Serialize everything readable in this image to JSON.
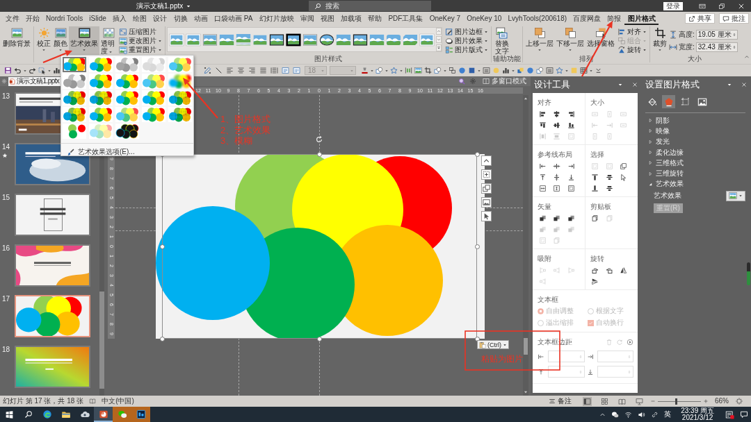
{
  "window": {
    "title": "演示文稿1.pptx",
    "search_placeholder": "搜索",
    "sign_in": "登录"
  },
  "tabs": [
    {
      "label": "文件",
      "selected": false
    },
    {
      "label": "开始",
      "selected": false
    },
    {
      "label": "Nordri Tools",
      "selected": false
    },
    {
      "label": "iSlide",
      "selected": false
    },
    {
      "label": "插入",
      "selected": false
    },
    {
      "label": "绘图",
      "selected": false
    },
    {
      "label": "设计",
      "selected": false
    },
    {
      "label": "切换",
      "selected": false
    },
    {
      "label": "动画",
      "selected": false
    },
    {
      "label": "口袋动画 PA",
      "selected": false
    },
    {
      "label": "幻灯片放映",
      "selected": false
    },
    {
      "label": "审阅",
      "selected": false
    },
    {
      "label": "视图",
      "selected": false
    },
    {
      "label": "加载项",
      "selected": false
    },
    {
      "label": "帮助",
      "selected": false
    },
    {
      "label": "PDF工具集",
      "selected": false
    },
    {
      "label": "OneKey 7",
      "selected": false
    },
    {
      "label": "OneKey 10",
      "selected": false
    },
    {
      "label": "LvyhTools(200618)",
      "selected": false
    },
    {
      "label": "百度网盘",
      "selected": false
    },
    {
      "label": "简报",
      "selected": false
    },
    {
      "label": "图片格式",
      "selected": true
    }
  ],
  "header_buttons": [
    {
      "kind": "share",
      "label": "共享"
    },
    {
      "kind": "comments",
      "label": "批注"
    }
  ],
  "ribbon": {
    "remove_background": "删除背景",
    "adjust": [
      {
        "kind": "correction",
        "label": "校正",
        "pressed": false
      },
      {
        "kind": "color",
        "label": "颜色",
        "pressed": false
      },
      {
        "kind": "artistic",
        "label": "艺术效果",
        "pressed": true
      },
      {
        "kind": "transparency",
        "label": "透明度",
        "pressed": false
      }
    ],
    "image_actions": [
      {
        "kind": "compress",
        "label": "压缩图片",
        "menu": false
      },
      {
        "kind": "change",
        "label": "更改图片",
        "menu": true
      },
      {
        "kind": "reset",
        "label": "重置图片",
        "menu": true
      }
    ],
    "styles": {
      "label": "图片样式",
      "items": [
        {
          "kind": "white-frame",
          "selected": false
        },
        {
          "kind": "white-frame",
          "selected": false
        },
        {
          "kind": "thin-frame",
          "selected": false
        },
        {
          "kind": "plain",
          "selected": false
        },
        {
          "kind": "reflection",
          "selected": false
        },
        {
          "kind": "soft-edge",
          "selected": false
        },
        {
          "kind": "black-frame",
          "selected": false
        },
        {
          "kind": "thick-black-frame",
          "selected": false
        },
        {
          "kind": "thin-frame",
          "selected": false
        },
        {
          "kind": "oval",
          "selected": false
        },
        {
          "kind": "plain",
          "selected": false
        },
        {
          "kind": "black-frame",
          "selected": false
        },
        {
          "kind": "plain",
          "selected": false
        },
        {
          "kind": "rounded",
          "selected": false
        },
        {
          "kind": "cut-corner",
          "selected": false
        },
        {
          "kind": "white-frame",
          "selected": false
        }
      ]
    },
    "picture_options": [
      {
        "kind": "border",
        "label": "图片边框"
      },
      {
        "kind": "effects",
        "label": "图片效果"
      },
      {
        "kind": "layout",
        "label": "图片版式"
      }
    ],
    "accessibility": {
      "button": "替换文字",
      "label": "辅助功能"
    },
    "arrange": {
      "label": "排列",
      "buttons": [
        {
          "kind": "forward",
          "label": "上移一层",
          "menu": true
        },
        {
          "kind": "backward",
          "label": "下移一层",
          "menu": true
        },
        {
          "kind": "pane",
          "label": "选择窗格",
          "menu": false
        }
      ],
      "options": [
        {
          "kind": "align",
          "label": "对齐",
          "disabled": false
        },
        {
          "kind": "group",
          "label": "组合",
          "disabled": true
        },
        {
          "kind": "rotate",
          "label": "旋转",
          "disabled": false
        }
      ]
    },
    "size": {
      "label": "大小",
      "crop": "裁剪",
      "height_label": "高度:",
      "height": "19.05 厘米",
      "width_label": "宽度:",
      "width": "32.43 厘米"
    }
  },
  "quick_access": {
    "font_size": {
      "value": "18",
      "disabled": true
    }
  },
  "art_effects_menu": {
    "items": [
      {
        "kind": "normal",
        "selected": true
      },
      {
        "kind": "normal",
        "selected": false
      },
      {
        "kind": "grayscale",
        "selected": false
      },
      {
        "kind": "sketch",
        "selected": false
      },
      {
        "kind": "soft",
        "selected": false
      },
      {
        "kind": "grayscale",
        "selected": false
      },
      {
        "kind": "normal",
        "selected": false
      },
      {
        "kind": "normal",
        "selected": false
      },
      {
        "kind": "soft",
        "selected": false
      },
      {
        "kind": "blur",
        "selected": false
      },
      {
        "kind": "textured",
        "selected": false
      },
      {
        "kind": "textured",
        "selected": false
      },
      {
        "kind": "normal",
        "selected": false
      },
      {
        "kind": "normal",
        "selected": false
      },
      {
        "kind": "textured",
        "selected": false
      },
      {
        "kind": "textured",
        "selected": false
      },
      {
        "kind": "normal",
        "selected": false
      },
      {
        "kind": "soft",
        "selected": false
      },
      {
        "kind": "normal",
        "selected": false
      },
      {
        "kind": "textured",
        "selected": false
      },
      {
        "kind": "muted",
        "selected": false
      },
      {
        "kind": "pastel",
        "selected": false
      },
      {
        "kind": "dark",
        "selected": false
      }
    ],
    "options_item": "艺术效果选项(E)..."
  },
  "document_tab": {
    "title": "演示文稿1.pptx"
  },
  "multi_window": "多窗口模式",
  "slides": [
    {
      "number": "13",
      "kind": "city-photo",
      "selected": false,
      "animated": false
    },
    {
      "number": "14",
      "kind": "sky-photo",
      "selected": false,
      "animated": true
    },
    {
      "number": "15",
      "kind": "text-frame",
      "selected": false,
      "animated": false
    },
    {
      "number": "16",
      "kind": "color-waves",
      "selected": false,
      "animated": false
    },
    {
      "number": "17",
      "kind": "circles",
      "selected": true,
      "animated": false
    },
    {
      "number": "18",
      "kind": "gradient",
      "selected": false,
      "animated": false
    }
  ],
  "ruler": {
    "horizontal": [
      "12",
      "11",
      "10",
      "9",
      "8",
      "7",
      "6",
      "5",
      "4",
      "3",
      "2",
      "1",
      "0",
      "1",
      "2",
      "3",
      "4",
      "5",
      "6",
      "7",
      "8",
      "9",
      "10",
      "11",
      "12",
      "13",
      "14",
      "15",
      "16"
    ],
    "vertical": [
      "9",
      "8",
      "7",
      "6",
      "5",
      "4",
      "3",
      "2",
      "1",
      "0",
      "1",
      "2",
      "3",
      "4",
      "5",
      "6",
      "7",
      "8",
      "9"
    ]
  },
  "canvas": {
    "paste_options": "(Ctrl)"
  },
  "design_tools": {
    "title": "设计工具",
    "sections": [
      {
        "title": "对齐",
        "tools": [
          {
            "disabled": false
          },
          {
            "disabled": false
          },
          {
            "disabled": false
          },
          {
            "disabled": false
          },
          {
            "disabled": false
          },
          {
            "disabled": false
          },
          {
            "disabled": true
          },
          {
            "disabled": true
          },
          {
            "disabled": true
          }
        ]
      },
      {
        "title": "大小",
        "tools": [
          {
            "disabled": true
          },
          {
            "disabled": true
          },
          {
            "disabled": true
          },
          {
            "disabled": true
          },
          {
            "disabled": true
          },
          {
            "disabled": true
          },
          {
            "disabled": true
          },
          {
            "disabled": true
          }
        ]
      },
      {
        "title": "参考线布局",
        "tools": [
          {
            "disabled": false
          },
          {
            "disabled": false
          },
          {
            "disabled": false
          },
          {
            "disabled": false
          },
          {
            "disabled": false
          },
          {
            "disabled": false
          },
          {
            "disabled": false
          },
          {
            "disabled": false
          },
          {
            "disabled": false
          }
        ]
      },
      {
        "title": "选择",
        "tools": [
          {
            "disabled": true
          },
          {
            "disabled": true
          },
          {
            "disabled": false
          },
          {
            "disabled": false
          },
          {
            "disabled": false
          },
          {
            "disabled": false
          },
          {
            "disabled": false
          },
          {
            "disabled": false
          }
        ]
      },
      {
        "title": "矢量",
        "tools": [
          {
            "disabled": false
          },
          {
            "disabled": false
          },
          {
            "disabled": false
          },
          {
            "disabled": true
          },
          {
            "disabled": true
          },
          {
            "disabled": true
          },
          {
            "disabled": true
          },
          {
            "disabled": true
          }
        ]
      },
      {
        "title": "剪贴板",
        "tools": [
          {
            "disabled": false
          },
          {
            "disabled": true
          }
        ]
      },
      {
        "title": "吸附",
        "tools": [
          {
            "disabled": true
          },
          {
            "disabled": true
          },
          {
            "disabled": true
          },
          {
            "disabled": true
          }
        ]
      },
      {
        "title": "旋转",
        "tools": [
          {
            "disabled": false
          },
          {
            "disabled": false
          },
          {
            "disabled": false
          },
          {
            "disabled": false
          }
        ]
      }
    ],
    "textbox": {
      "title": "文本框",
      "disabled": true,
      "options": [
        {
          "kind": "radio",
          "label": "自由调整",
          "checked": true
        },
        {
          "kind": "radio",
          "label": "根据文字",
          "checked": false
        },
        {
          "kind": "radio",
          "label": "溢出缩排",
          "checked": false
        },
        {
          "kind": "checkbox",
          "label": "自动换行",
          "checked": true
        }
      ]
    },
    "margins": {
      "title": "文本框边距"
    }
  },
  "format_panel": {
    "title": "设置图片格式",
    "tabs": [
      {
        "kind": "fill",
        "selected": false
      },
      {
        "kind": "effects",
        "selected": true
      },
      {
        "kind": "size",
        "selected": false
      },
      {
        "kind": "picture",
        "selected": false
      }
    ],
    "groups": [
      {
        "label": "阴影",
        "expanded": false
      },
      {
        "label": "映像",
        "expanded": false
      },
      {
        "label": "发光",
        "expanded": false
      },
      {
        "label": "柔化边缘",
        "expanded": false
      },
      {
        "label": "三维格式",
        "expanded": false
      },
      {
        "label": "三维旋转",
        "expanded": false
      },
      {
        "label": "艺术效果",
        "expanded": true,
        "setting": "艺术效果",
        "reset": {
          "label": "重置(R)",
          "disabled": true
        }
      }
    ]
  },
  "status_bar": {
    "slide_info": "幻灯片 第 17 张，共 18 张",
    "language": "中文(中国)",
    "notes": "备注",
    "views": [
      {
        "kind": "normal",
        "selected": true
      },
      {
        "kind": "sorter",
        "selected": false
      },
      {
        "kind": "reading",
        "selected": false
      },
      {
        "kind": "slideshow",
        "selected": false
      }
    ],
    "zoom": {
      "level": 0.42,
      "reading": "66%"
    }
  },
  "taskbar": {
    "apps": [
      {
        "kind": "browser",
        "active": false,
        "attention": false
      },
      {
        "kind": "folder",
        "active": false,
        "attention": false
      },
      {
        "kind": "cloud",
        "active": false,
        "attention": false
      },
      {
        "kind": "presentation",
        "active": true,
        "attention": false
      },
      {
        "kind": "chat",
        "active": false,
        "attention": true
      },
      {
        "kind": "image-editor",
        "active": false,
        "attention": true
      }
    ],
    "input_method": "英",
    "time": "23:39 周五",
    "date": "2021/3/12"
  },
  "annotations": {
    "steps": [
      "1、图片格式",
      "2、艺术效果",
      "3、模糊"
    ],
    "paste_note": "粘贴为图片"
  }
}
